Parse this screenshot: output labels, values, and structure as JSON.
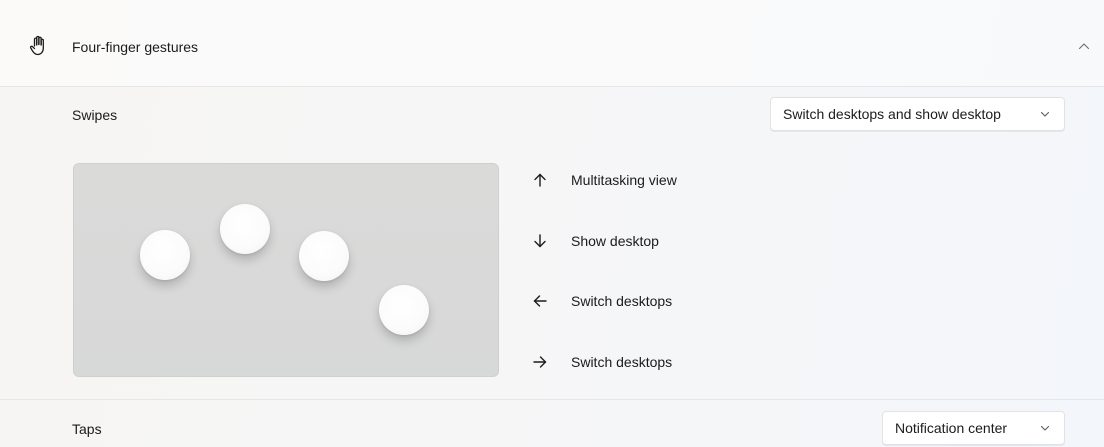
{
  "section": {
    "title": "Four-finger gestures",
    "header_icon": "hand-gesture-icon",
    "collapse_icon": "chevron-up-icon"
  },
  "swipes": {
    "label": "Swipes",
    "dropdown_value": "Switch desktops and show desktop",
    "gestures": [
      {
        "icon": "arrow-up-icon",
        "label": "Multitasking view"
      },
      {
        "icon": "arrow-down-icon",
        "label": "Show desktop"
      },
      {
        "icon": "arrow-left-icon",
        "label": "Switch desktops"
      },
      {
        "icon": "arrow-right-icon",
        "label": "Switch desktops"
      }
    ]
  },
  "taps": {
    "label": "Taps",
    "dropdown_value": "Notification center"
  }
}
